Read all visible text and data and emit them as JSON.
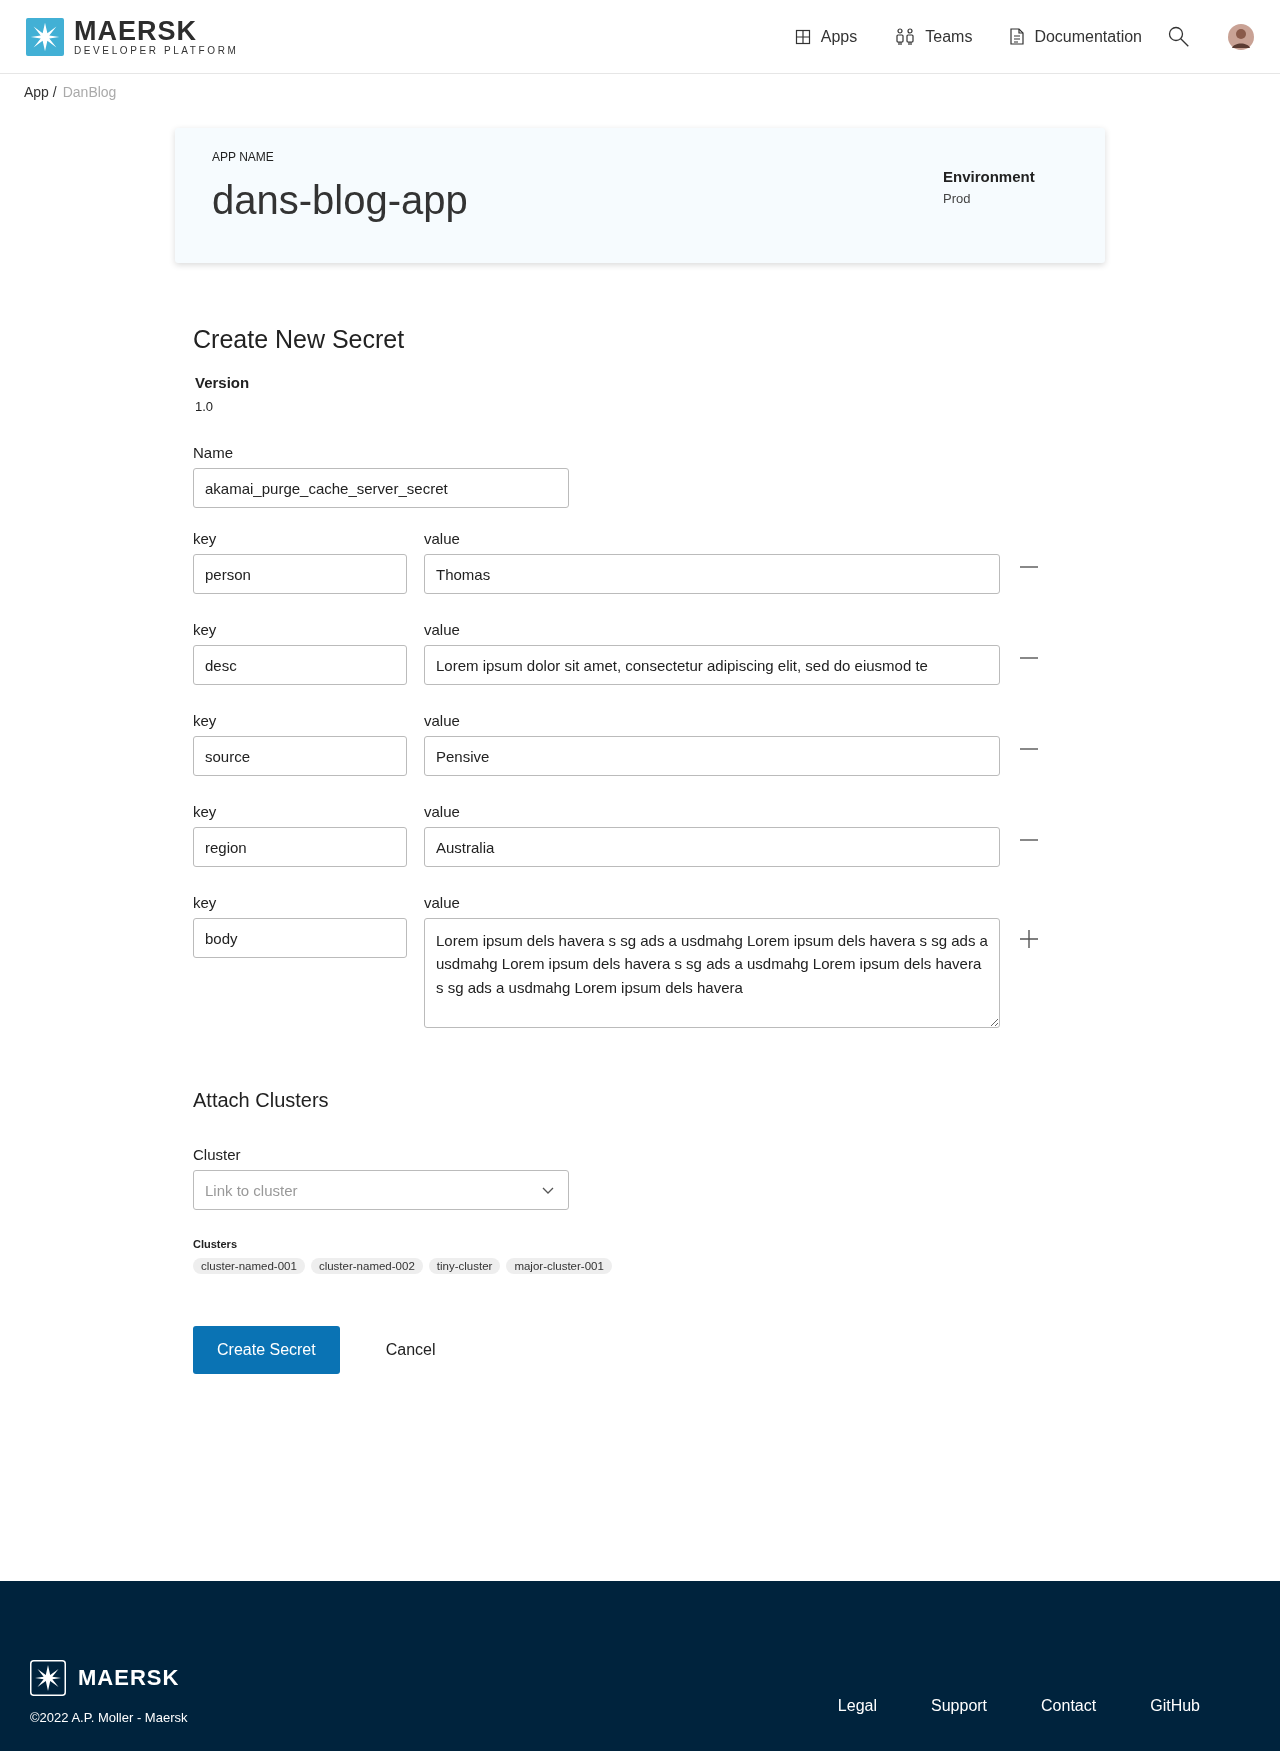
{
  "header": {
    "logo_name": "MAERSK",
    "logo_sub": "DEVELOPER PLATFORM",
    "nav": [
      {
        "label": "Apps"
      },
      {
        "label": "Teams"
      },
      {
        "label": "Documentation"
      }
    ]
  },
  "breadcrumb": {
    "items": [
      "App /"
    ],
    "current": "DanBlog"
  },
  "app_card": {
    "label": "APP NAME",
    "name": "dans-blog-app",
    "env_label": "Environment",
    "env_value": "Prod"
  },
  "form": {
    "title": "Create New Secret",
    "version_label": "Version",
    "version": "1.0",
    "name_label": "Name",
    "name_value": "akamai_purge_cache_server_secret",
    "pairs": [
      {
        "key_label": "key",
        "key": "person",
        "value_label": "value",
        "value": "Thomas",
        "kind": "input"
      },
      {
        "key_label": "key",
        "key": "desc",
        "value_label": "value",
        "value": "Lorem ipsum dolor sit amet, consectetur adipiscing elit, sed do eiusmod te",
        "kind": "input"
      },
      {
        "key_label": "key",
        "key": "source",
        "value_label": "value",
        "value": "Pensive",
        "kind": "input"
      },
      {
        "key_label": "key",
        "key": "region",
        "value_label": "value",
        "value": "Australia",
        "kind": "input"
      },
      {
        "key_label": "key",
        "key": "body",
        "value_label": "value",
        "value": "Lorem ipsum dels havera s sg ads a usdmahg Lorem ipsum dels havera s sg ads a usdmahg Lorem ipsum dels havera s sg ads a usdmahg Lorem ipsum dels havera s sg ads a usdmahg Lorem ipsum dels havera",
        "kind": "textarea"
      }
    ]
  },
  "clusters": {
    "title": "Attach Clusters",
    "select_label": "Cluster",
    "select_placeholder": "Link to cluster",
    "list_label": "Clusters",
    "tags": [
      "cluster-named-001",
      "cluster-named-002",
      "tiny-cluster",
      "major-cluster-001"
    ]
  },
  "actions": {
    "primary": "Create Secret",
    "secondary": "Cancel"
  },
  "footer": {
    "logo_name": "MAERSK",
    "copyright": "©2022 A.P. Moller - Maersk",
    "links": [
      "Legal",
      "Support",
      "Contact",
      "GitHub"
    ]
  }
}
